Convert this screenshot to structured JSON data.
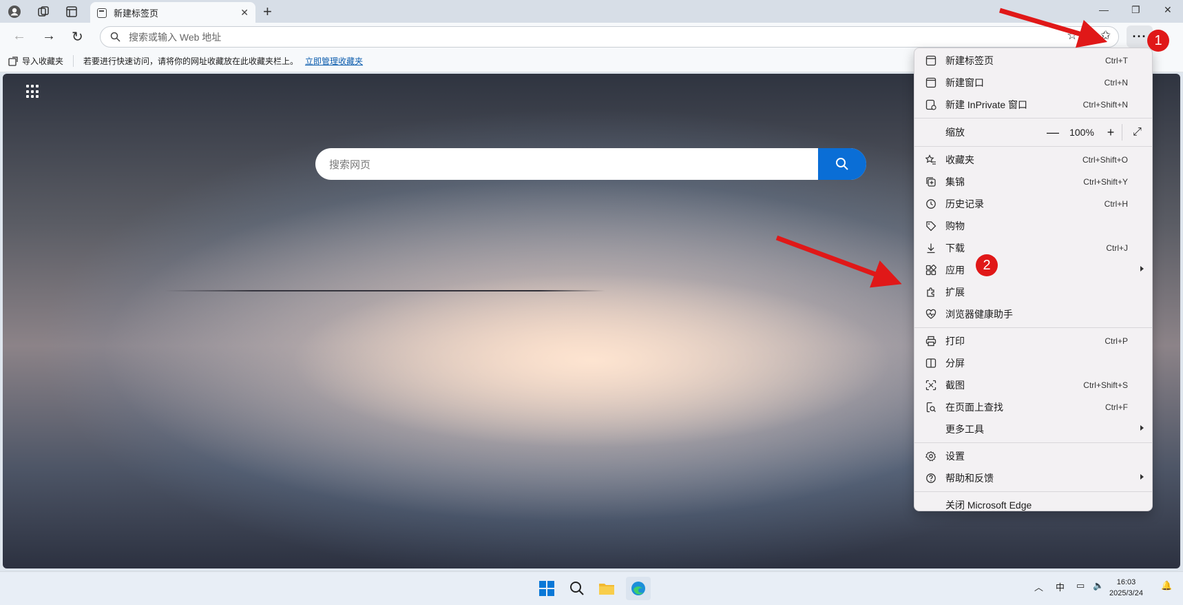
{
  "tab": {
    "title": "新建标签页"
  },
  "address": {
    "placeholder": "搜索或输入 Web 地址"
  },
  "favorites_bar": {
    "import_label": "导入收藏夹",
    "hint": "若要进行快速访问，请将你的网址收藏放在此收藏夹栏上。",
    "manage_link": "立即管理收藏夹"
  },
  "content": {
    "search_placeholder": "搜索网页"
  },
  "menu": {
    "items_group1": [
      {
        "label": "新建标签页",
        "shortcut": "Ctrl+T",
        "icon": "new-tab-icon"
      },
      {
        "label": "新建窗口",
        "shortcut": "Ctrl+N",
        "icon": "new-window-icon"
      },
      {
        "label": "新建 InPrivate 窗口",
        "shortcut": "Ctrl+Shift+N",
        "icon": "inprivate-icon"
      }
    ],
    "zoom": {
      "label": "缩放",
      "minus": "—",
      "value": "100%",
      "plus": "+"
    },
    "items_group2": [
      {
        "label": "收藏夹",
        "shortcut": "Ctrl+Shift+O",
        "icon": "favorites-icon"
      },
      {
        "label": "集锦",
        "shortcut": "Ctrl+Shift+Y",
        "icon": "collections-icon"
      },
      {
        "label": "历史记录",
        "shortcut": "Ctrl+H",
        "icon": "history-icon"
      },
      {
        "label": "购物",
        "shortcut": "",
        "icon": "shopping-tag-icon"
      },
      {
        "label": "下载",
        "shortcut": "Ctrl+J",
        "icon": "download-icon"
      },
      {
        "label": "应用",
        "shortcut": "",
        "icon": "apps-icon",
        "submenu": true
      },
      {
        "label": "扩展",
        "shortcut": "",
        "icon": "extensions-icon"
      },
      {
        "label": "浏览器健康助手",
        "shortcut": "",
        "icon": "health-heart-icon"
      }
    ],
    "items_group3": [
      {
        "label": "打印",
        "shortcut": "Ctrl+P",
        "icon": "print-icon"
      },
      {
        "label": "分屏",
        "shortcut": "",
        "icon": "split-screen-icon"
      },
      {
        "label": "截图",
        "shortcut": "Ctrl+Shift+S",
        "icon": "screenshot-icon"
      },
      {
        "label": "在页面上查找",
        "shortcut": "Ctrl+F",
        "icon": "find-icon"
      },
      {
        "label": "更多工具",
        "shortcut": "",
        "icon": "",
        "submenu": true
      }
    ],
    "items_group4": [
      {
        "label": "设置",
        "shortcut": "",
        "icon": "settings-gear-icon"
      },
      {
        "label": "帮助和反馈",
        "shortcut": "",
        "icon": "help-icon",
        "submenu": true
      }
    ],
    "close_label": "关闭 Microsoft Edge"
  },
  "taskbar": {
    "ime": "中",
    "time": "16:03",
    "date": "2025/3/24"
  },
  "annotations": {
    "badge1": "1",
    "badge2": "2",
    "color": "#e01818"
  }
}
